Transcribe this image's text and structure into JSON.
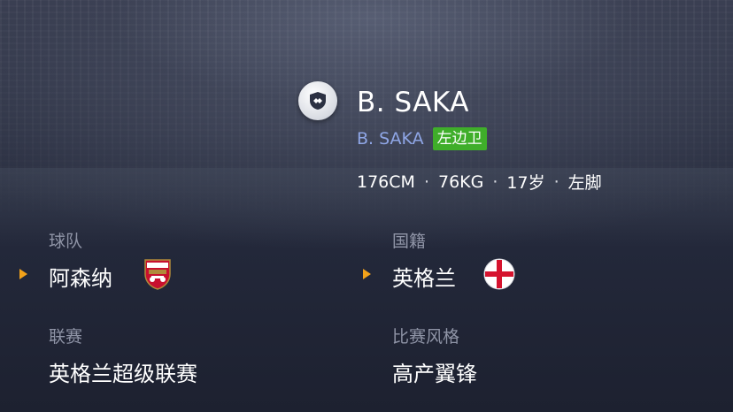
{
  "colors": {
    "accent_subname": "#8fa6e6",
    "position_tag_bg": "#3fae2a",
    "arrow": "#f2a21a",
    "label": "#8f94a6"
  },
  "player": {
    "logo_icon": "player-badge-icon",
    "name": "B. SAKA",
    "subname": "B. SAKA",
    "position": "左边卫",
    "height": "176CM",
    "weight": "76KG",
    "age": "17岁",
    "foot": "左脚",
    "separator": "·"
  },
  "info": {
    "team": {
      "label": "球队",
      "value": "阿森纳",
      "icon": "arsenal-crest-icon"
    },
    "nationality": {
      "label": "国籍",
      "value": "英格兰",
      "icon": "england-flag-icon"
    },
    "league": {
      "label": "联赛",
      "value": "英格兰超级联赛"
    },
    "style": {
      "label": "比赛风格",
      "value": "高产翼锋"
    }
  }
}
